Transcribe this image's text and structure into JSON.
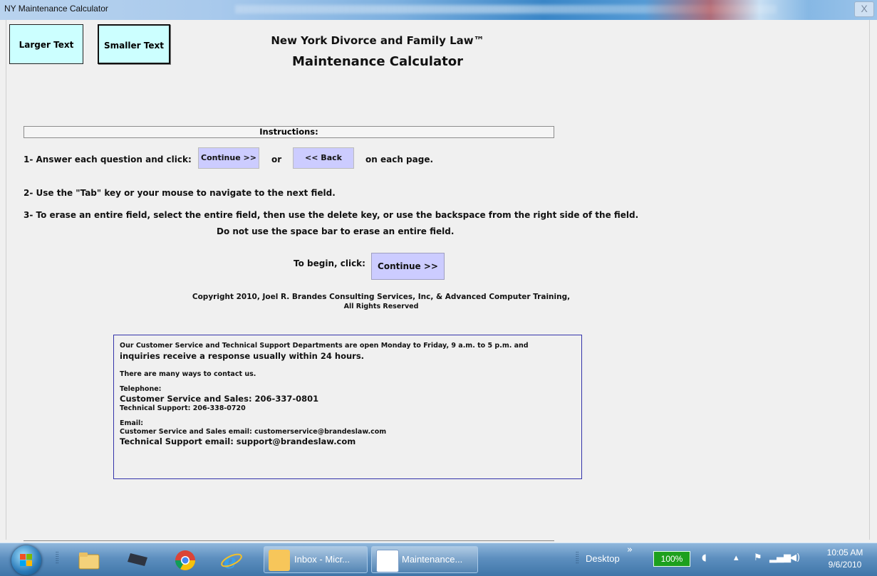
{
  "window": {
    "title": "NY Maintenance Calculator",
    "close_glyph": "X"
  },
  "toolbar": {
    "larger_text": "Larger Text",
    "smaller_text": "Smaller Text"
  },
  "header": {
    "line1": "New York Divorce and Family Law™",
    "line2": "Maintenance Calculator"
  },
  "instructions": {
    "heading": "Instructions:",
    "step1_prefix": "1- Answer each question and click:",
    "continue_label": "Continue >>",
    "or_label": "or",
    "back_label": "<< Back",
    "step1_suffix": "on each page.",
    "step2": "2- Use the \"Tab\" key or your mouse to navigate to the next field.",
    "step3": "3- To erase an entire field, select the entire field, then use the delete key, or use the  backspace from the right side of the field.",
    "step3_note": "Do not use the space bar to erase an entire field."
  },
  "begin": {
    "prompt": "To begin, click:",
    "button_label": "Continue >>"
  },
  "copyright": {
    "line1": "Copyright 2010, Joel R. Brandes Consulting Services, Inc, & Advanced Computer Training,",
    "line2": "All Rights Reserved"
  },
  "contact": {
    "line1": "Our Customer Service and Technical Support Departments are open Monday to Friday, 9 a.m. to 5 p.m. and",
    "line2": "inquiries receive a response usually within 24 hours.",
    "line3": "There are many ways to contact us.",
    "telephone_heading": "Telephone:",
    "sales_phone": "Customer Service and Sales: 206-337-0801",
    "tech_phone": "Technical Support: 206-338-0720",
    "email_heading": "Email:",
    "sales_email": "Customer Service and Sales email: customerservice@brandeslaw.com",
    "tech_email": "Technical Support email: support@brandeslaw.com"
  },
  "taskbar": {
    "items": [
      {
        "label": "Inbox - Micr...",
        "icon": "outlook-icon"
      },
      {
        "label": "Maintenance...",
        "icon": "word-document-icon"
      }
    ],
    "desktop_label": "Desktop",
    "chevron": "»",
    "battery": "100%",
    "time": "10:05 AM",
    "date": "9/6/2010"
  }
}
